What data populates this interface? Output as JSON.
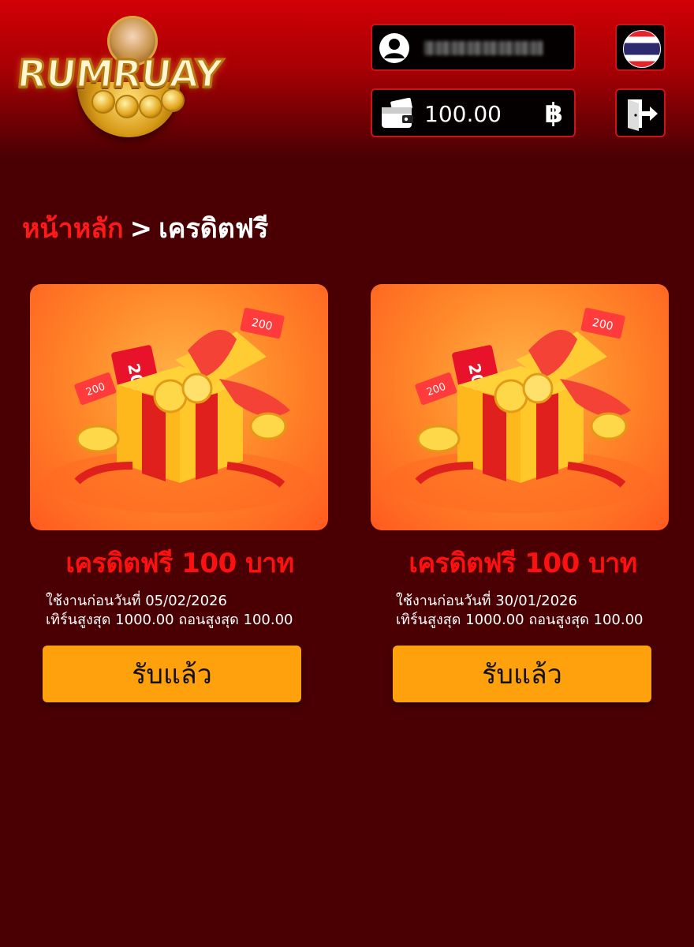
{
  "header": {
    "logo_text": "RUMRUAY",
    "balance": "100.00",
    "currency_symbol": "฿"
  },
  "breadcrumb": {
    "home": "หน้าหลัก",
    "separator": ">",
    "current": "เครดิตฟรี"
  },
  "cards": [
    {
      "title": "เครดิตฟรี 100 บาท",
      "expire_line": "ใช้งานก่อนวันที่ 05/02/2026",
      "limit_line": "เทิร์นสูงสุด 1000.00 ถอนสูงสุด 100.00",
      "button_label": "รับแล้ว",
      "ticket_label": "200"
    },
    {
      "title": "เครดิตฟรี 100 บาท",
      "expire_line": "ใช้งานก่อนวันที่ 30/01/2026",
      "limit_line": "เทิร์นสูงสุด 1000.00 ถอนสูงสุด 100.00",
      "button_label": "รับแล้ว",
      "ticket_label": "200"
    }
  ],
  "colors": {
    "page_bg": "#4a0003",
    "accent_red": "#ff1010",
    "button": "#ffa10d",
    "header_red": "#d10006"
  },
  "icons": [
    "user-icon",
    "wallet-icon",
    "thai-flag-icon",
    "logout-icon",
    "gift-box-illustration"
  ]
}
